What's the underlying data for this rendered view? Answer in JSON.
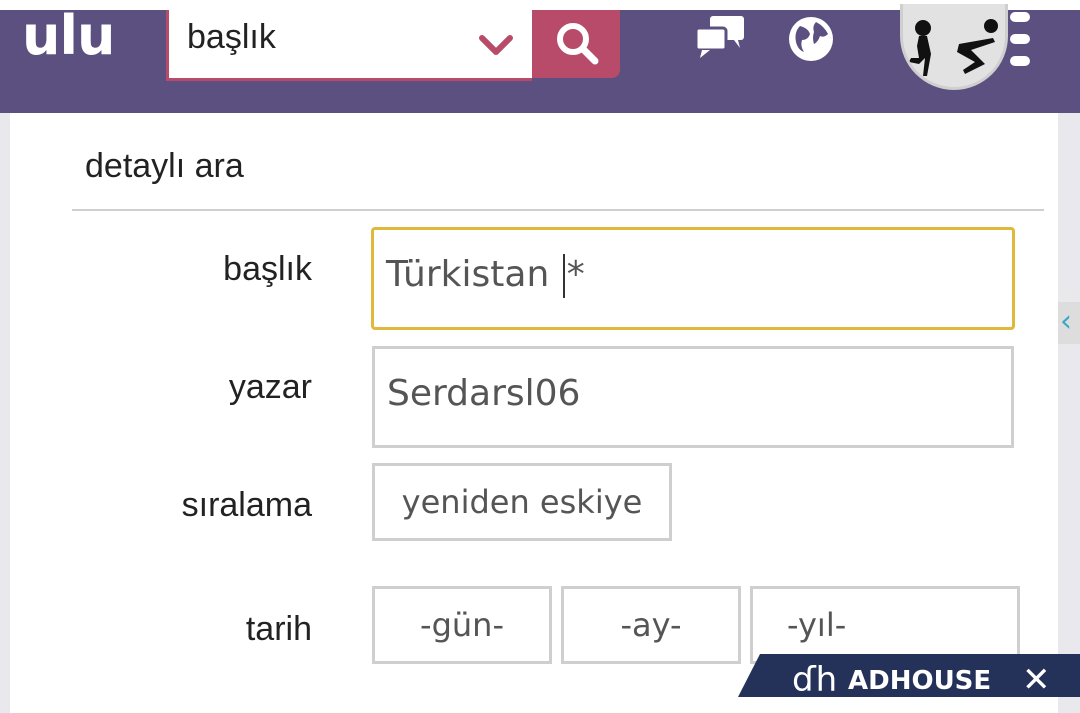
{
  "header": {
    "logo": "ulu",
    "search": {
      "value": "başlık"
    }
  },
  "detailed_search": {
    "title": "detaylı ara",
    "fields": {
      "title_label": "başlık",
      "title_value": "Türkistan",
      "title_suffix": "*",
      "author_label": "yazar",
      "author_value": "Serdarsl06",
      "sort_label": "sıralama",
      "sort_value": "yeniden eskiye",
      "date_label": "tarih",
      "day_placeholder": "-gün-",
      "month_placeholder": "-ay-",
      "year_placeholder": "-yıl-"
    }
  },
  "ad": {
    "brand": "ADHOUSE",
    "logo_glyph": "ɗh",
    "close_glyph": "✕"
  },
  "side_arrow": "‹",
  "colors": {
    "header_bg": "#5b5080",
    "accent": "#b84a6a",
    "focus": "#e0b83c",
    "ad_bg": "#24325a"
  }
}
